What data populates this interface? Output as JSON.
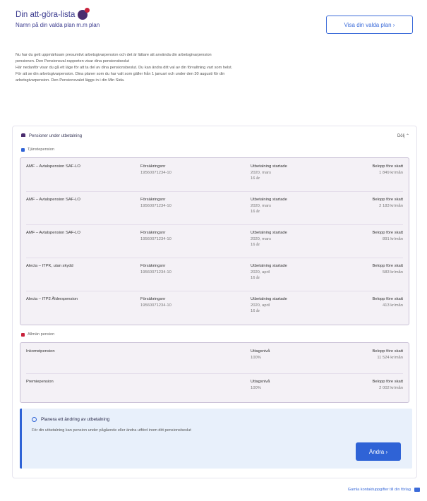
{
  "header": {
    "title": "Din att-göra-lista",
    "subtitle": "Namn på din valda plan m.m plan",
    "show_plan_label": "Visa din valda plan  ›"
  },
  "intro": {
    "lines": [
      "Nu har du gett uppmärksam presumtivt arbetsgivarpension och det är lättare att använda din arbetsgivarpension",
      "pensionen. Den Pensionsval-rapporten visar dina pensionsbeslut",
      "Här nedanför visar du gå ett läge för att ta del av dina pensionsbeslut. Du kan ändra ditt val av din förvaltning vart som helst.",
      "För att se din arbetsgivarpension. Dina planer som du har valt som gäller från 1 januari och under den 30 augusti för din",
      "arbetsgivarpension. Den Pensionsvalet läggs in i din Min Sida."
    ]
  },
  "card": {
    "head_title": "Pensioner under utbetalning",
    "collapse_label": "Dölj  ⌃",
    "section1_label": "Tjänstepension",
    "section1_color": "#2f63d6",
    "section2_label": "Allmän pension",
    "section2_color": "#c8223c",
    "rows": [
      {
        "name": "AMF – Avtalspension SAF-LO",
        "c2_label": "Försäkringsnr",
        "c2_value": "19560071234-10",
        "c3_label": "Utbetalning startade",
        "c3_value": "2020, mars",
        "c3_extra": "16 år",
        "c4_label": "Belopp före skatt",
        "c4_value": "1 849 kr/mån"
      },
      {
        "name": "AMF – Avtalspension SAF-LO",
        "c2_label": "Försäkringsnr",
        "c2_value": "19560071234-10",
        "c3_label": "Utbetalning startade",
        "c3_value": "2020, mars",
        "c3_extra": "16 år",
        "c4_label": "Belopp före skatt",
        "c4_value": "2 183 kr/mån"
      },
      {
        "name": "AMF – Avtalspension SAF-LO",
        "c2_label": "Försäkringsnr",
        "c2_value": "19560071234-10",
        "c3_label": "Utbetalning startade",
        "c3_value": "2020, mars",
        "c3_extra": "16 år",
        "c4_label": "Belopp före skatt",
        "c4_value": "891 kr/mån"
      },
      {
        "name": "Alecta – ITPK, utan skydd",
        "c2_label": "Försäkringsnr",
        "c2_value": "19560071234-10",
        "c3_label": "Utbetalning startade",
        "c3_value": "2020, april",
        "c3_extra": "16 år",
        "c4_label": "Belopp före skatt",
        "c4_value": "583 kr/mån"
      },
      {
        "name": "Alecta – ITP2 Ålderspension",
        "c2_label": "Försäkringsnr",
        "c2_value": "19560071234-10",
        "c3_label": "Utbetalning startade",
        "c3_value": "2020, april",
        "c3_extra": "16 år",
        "c4_label": "Belopp före skatt",
        "c4_value": "413 kr/mån"
      }
    ],
    "public_rows": [
      {
        "name": "Inkomstpension",
        "c3_label": "Uttagsnivå",
        "c3_value": "100%",
        "c4_label": "Belopp före skatt",
        "c4_value": "11 524 kr/mån"
      },
      {
        "name": "Premiepension",
        "c3_label": "Uttagsnivå",
        "c3_value": "100%",
        "c4_label": "Belopp före skatt",
        "c4_value": "2 002 kr/mån"
      }
    ],
    "info": {
      "title": "Planera ett ändring av utbetalning",
      "text": "För din utbetalning kan pension under pågående eller ändra utförd inom ditt pensionsbeslut",
      "change_label": "Ändra  ›"
    }
  },
  "footer": {
    "link": "Gamla kontaktuppgifter till din förlag"
  }
}
